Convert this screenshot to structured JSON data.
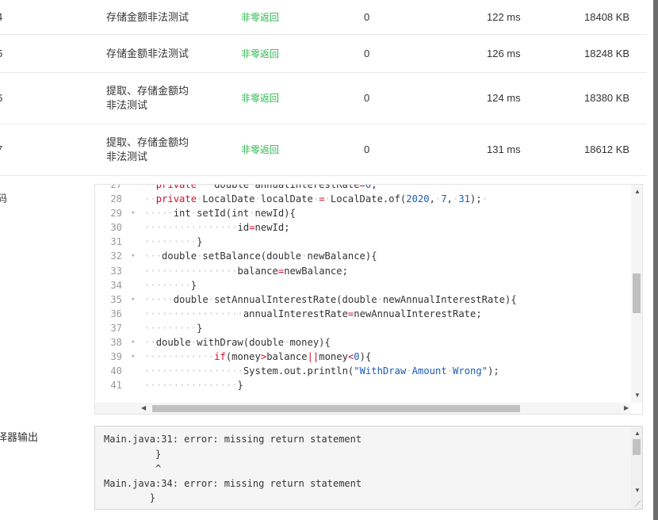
{
  "results": [
    {
      "idx": "4",
      "name_lines": [
        "存储金额非法测试"
      ],
      "status": "非零返回",
      "score": "0",
      "time": "122 ms",
      "memory": "18408 KB"
    },
    {
      "idx": "5",
      "name_lines": [
        "存储金额非法测试"
      ],
      "status": "非零返回",
      "score": "0",
      "time": "126 ms",
      "memory": "18248 KB"
    },
    {
      "idx": "6",
      "name_lines": [
        "提取、存储金额均",
        "非法测试"
      ],
      "status": "非零返回",
      "score": "0",
      "time": "124 ms",
      "memory": "18380 KB"
    },
    {
      "idx": "7",
      "name_lines": [
        "提取、存储金额均",
        "非法测试"
      ],
      "status": "非零返回",
      "score": "0",
      "time": "131 ms",
      "memory": "18612 KB"
    }
  ],
  "labels": {
    "code": "码",
    "compiler_output": "译器输出"
  },
  "code_lines": [
    {
      "n": "27",
      "fold": false,
      "text": "··private···double·annualInterestRate=0;"
    },
    {
      "n": "28",
      "fold": false,
      "text": "··private·LocalDate·localDate·=·LocalDate.of(2020,·7,·31);·"
    },
    {
      "n": "29",
      "fold": true,
      "text": "·····int·setId(int·newId){"
    },
    {
      "n": "30",
      "fold": false,
      "text": "················id=newId;"
    },
    {
      "n": "31",
      "fold": false,
      "text": "·········}"
    },
    {
      "n": "32",
      "fold": true,
      "text": "···double·setBalance(double·newBalance){"
    },
    {
      "n": "33",
      "fold": false,
      "text": "················balance=newBalance;"
    },
    {
      "n": "34",
      "fold": false,
      "text": "········}"
    },
    {
      "n": "35",
      "fold": true,
      "text": "·····double·setAnnualInterestRate(double·newAnnualInterestRate){"
    },
    {
      "n": "36",
      "fold": false,
      "text": "·················annualInterestRate=newAnnualInterestRate;"
    },
    {
      "n": "37",
      "fold": false,
      "text": "·········}"
    },
    {
      "n": "38",
      "fold": true,
      "text": "··double·withDraw(double·money){"
    },
    {
      "n": "39",
      "fold": true,
      "text": "············if(money>balance||money<0){"
    },
    {
      "n": "40",
      "fold": false,
      "text": "·················System.out.println(\"WithDraw·Amount·Wrong\");"
    },
    {
      "n": "41",
      "fold": false,
      "text": "················}"
    }
  ],
  "compiler_output": "Main.java:31: error: missing return statement\n         }\n         ^\nMain.java:34: error: missing return statement\n        }\n        ^",
  "colors": {
    "status_green": "#2db84d",
    "keyword_red": "#d0102c",
    "number_blue": "#1a5cb8"
  },
  "icons": {
    "fold": "fold-arrow-icon",
    "scroll_up": "up-arrow-icon",
    "scroll_down": "down-arrow-icon",
    "scroll_left": "left-arrow-icon",
    "scroll_right": "right-arrow-icon",
    "resize": "resize-grip-icon"
  }
}
